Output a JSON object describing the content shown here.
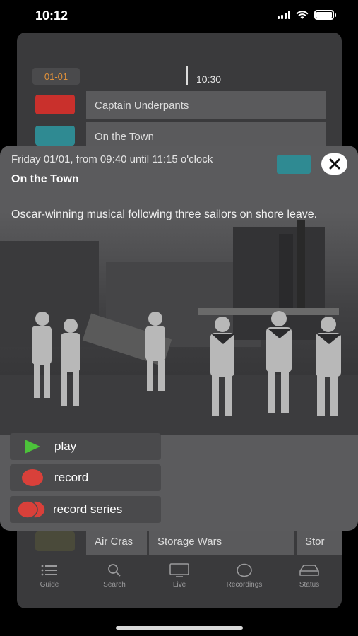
{
  "status_bar": {
    "time": "10:12"
  },
  "guide": {
    "date": "01-01",
    "time_marker": "10:30",
    "programs": [
      {
        "title": "Captain Underpants"
      },
      {
        "title": "On the Town"
      }
    ],
    "bottom_row": [
      {
        "title": "Air Cras"
      },
      {
        "title": "Storage Wars"
      },
      {
        "title": "Stor"
      }
    ]
  },
  "tab_bar": {
    "items": [
      {
        "label": "Guide",
        "icon": "list-icon"
      },
      {
        "label": "Search",
        "icon": "search-icon"
      },
      {
        "label": "Live",
        "icon": "tv-icon"
      },
      {
        "label": "Recordings",
        "icon": "recordings-icon"
      },
      {
        "label": "Status",
        "icon": "hard-drive-icon"
      }
    ]
  },
  "modal": {
    "schedule": "Friday 01/01, from 09:40 until 11:15 o'clock",
    "title": "On the Town",
    "description": "Oscar-winning musical following three sailors on shore leave.",
    "actions": [
      {
        "label": "play",
        "icon": "play-icon"
      },
      {
        "label": "record",
        "icon": "record-icon"
      },
      {
        "label": "record series",
        "icon": "record-series-icon"
      }
    ]
  },
  "colors": {
    "date_accent": "#e0913a",
    "play_green": "#4cc23a",
    "record_red": "#d9403a",
    "channel_red": "#c9302c",
    "channel_teal": "#2f8a92"
  }
}
